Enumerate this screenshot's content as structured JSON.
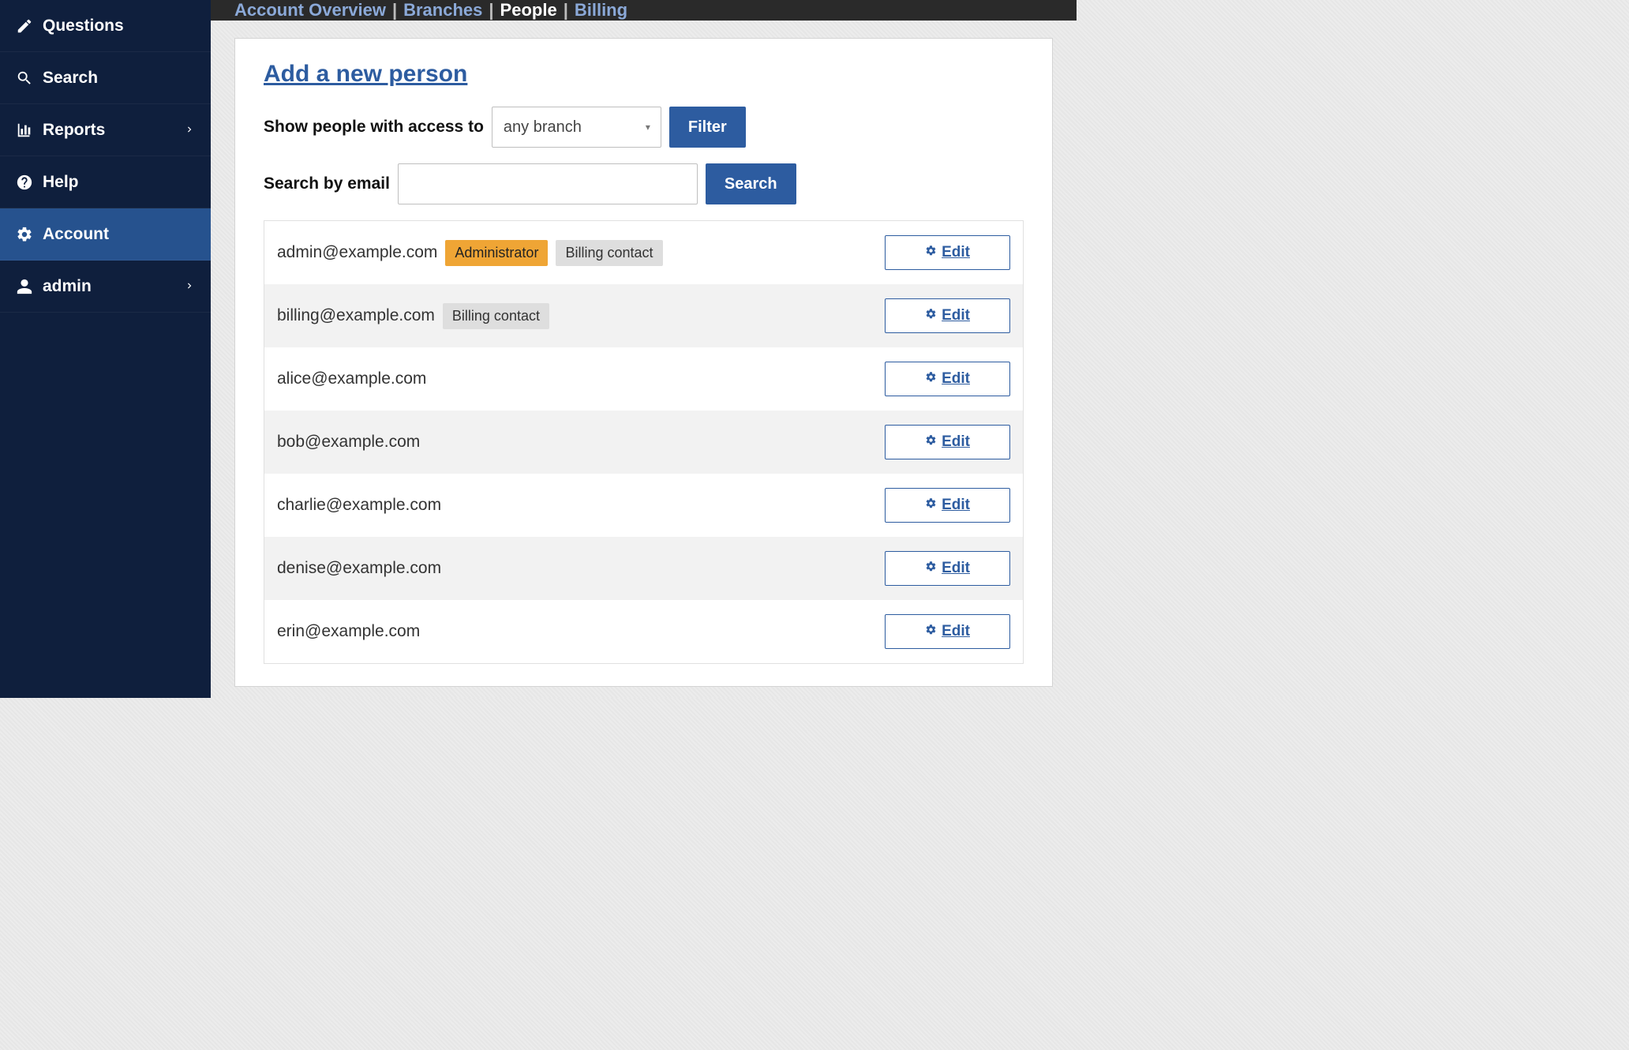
{
  "sidebar": {
    "items": [
      {
        "label": "Questions",
        "icon": "edit",
        "chevron": false,
        "active": false
      },
      {
        "label": "Search",
        "icon": "search",
        "chevron": false,
        "active": false
      },
      {
        "label": "Reports",
        "icon": "chart",
        "chevron": true,
        "active": false
      },
      {
        "label": "Help",
        "icon": "help",
        "chevron": false,
        "active": false
      },
      {
        "label": "Account",
        "icon": "gear",
        "chevron": false,
        "active": true
      },
      {
        "label": "admin",
        "icon": "user",
        "chevron": true,
        "active": false
      }
    ]
  },
  "topbar": {
    "items": [
      {
        "label": "Account Overview",
        "active": false
      },
      {
        "label": "Branches",
        "active": false
      },
      {
        "label": "People",
        "active": true
      },
      {
        "label": "Billing",
        "active": false
      }
    ]
  },
  "main": {
    "add_link": "Add a new person",
    "filter_label": "Show people with access to",
    "branch_select": "any branch",
    "filter_button": "Filter",
    "search_label": "Search by email",
    "search_value": "",
    "search_button": "Search",
    "edit_label": "Edit",
    "people": [
      {
        "email": "admin@example.com",
        "badges": [
          {
            "text": "Administrator",
            "type": "admin"
          },
          {
            "text": "Billing contact",
            "type": "billing"
          }
        ]
      },
      {
        "email": "billing@example.com",
        "badges": [
          {
            "text": "Billing contact",
            "type": "billing"
          }
        ]
      },
      {
        "email": "alice@example.com",
        "badges": []
      },
      {
        "email": "bob@example.com",
        "badges": []
      },
      {
        "email": "charlie@example.com",
        "badges": []
      },
      {
        "email": "denise@example.com",
        "badges": []
      },
      {
        "email": "erin@example.com",
        "badges": []
      }
    ]
  }
}
